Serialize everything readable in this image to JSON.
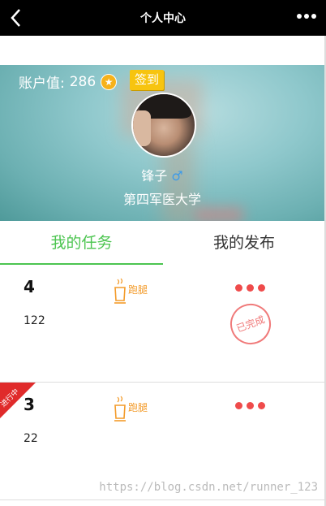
{
  "nav": {
    "title": "个人中心"
  },
  "profile": {
    "account_label": "账户值:",
    "account_value": "286",
    "sign_label": "签到",
    "name": "锋子",
    "gender_symbol": "♂",
    "school": "第四军医大学"
  },
  "tabs": [
    {
      "label": "我的任务",
      "active": true
    },
    {
      "label": "我的发布",
      "active": false
    }
  ],
  "tasks": [
    {
      "number": "4",
      "sub": "122",
      "type": "跑腿",
      "stamp": "已完成",
      "ribbon": ""
    },
    {
      "number": "3",
      "sub": "22",
      "type": "跑腿",
      "stamp": "",
      "ribbon": "进行中"
    }
  ],
  "watermark": "https://blog.csdn.net/runner_123",
  "colors": {
    "accent_green": "#4cc550",
    "accent_orange": "#f39b2a",
    "dot_red": "#ef4b4b",
    "ribbon_red": "#e02b2b"
  }
}
